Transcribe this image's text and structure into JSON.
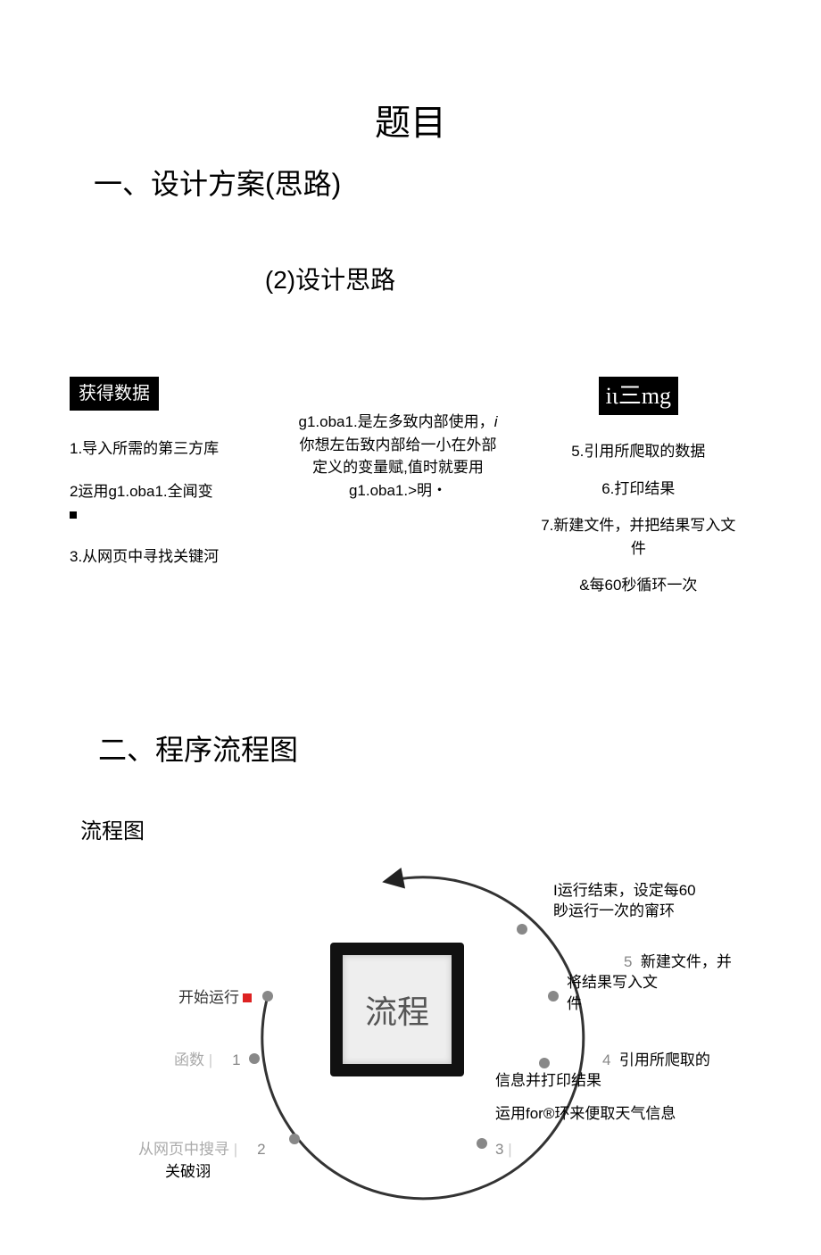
{
  "title": "题目",
  "section1": "一、设计方案(思路)",
  "sub1": "(2)设计思路",
  "col_left": {
    "badge": "获得数据",
    "l1": "1.导入所需的第三方库",
    "l2": "2运用g1.oba1.全闻变",
    "l3": "3.从网页中寻找关键河"
  },
  "col_mid": {
    "text_a": "g1.oba1.是左多致内部使用，",
    "text_i": "i",
    "text_b": "你想左缶致内部给一小在外部定义的变量赋,值时就要用g1.oba1.>明・"
  },
  "col_right": {
    "badge": "iι三mg",
    "r1": "5.引用所爬取的数据",
    "r2": "6.打印结果",
    "r3": "7.新建文件，并把结果写入文件",
    "r4": "&每60秒循环一次"
  },
  "section2": "二、程序流程图",
  "flow_label": "流程图",
  "center": "流程",
  "diagram": {
    "start": "开始运行",
    "fn": "函数",
    "search": "从网页中搜寻",
    "keyword": "关破诩",
    "for_loop": "运用for®环来便取天气信息",
    "step4_a": "引用所爬取的",
    "step4_b": "信息并打印结果",
    "step5_a": "新建文件，并",
    "step5_b": "将结果写入文",
    "step5_c": "件",
    "end_a": "I运行结束，设定每60",
    "end_b": "眇运行一次的甯环",
    "n1": "1",
    "n2": "2",
    "n3": "3",
    "n4": "4",
    "n5": "5"
  }
}
